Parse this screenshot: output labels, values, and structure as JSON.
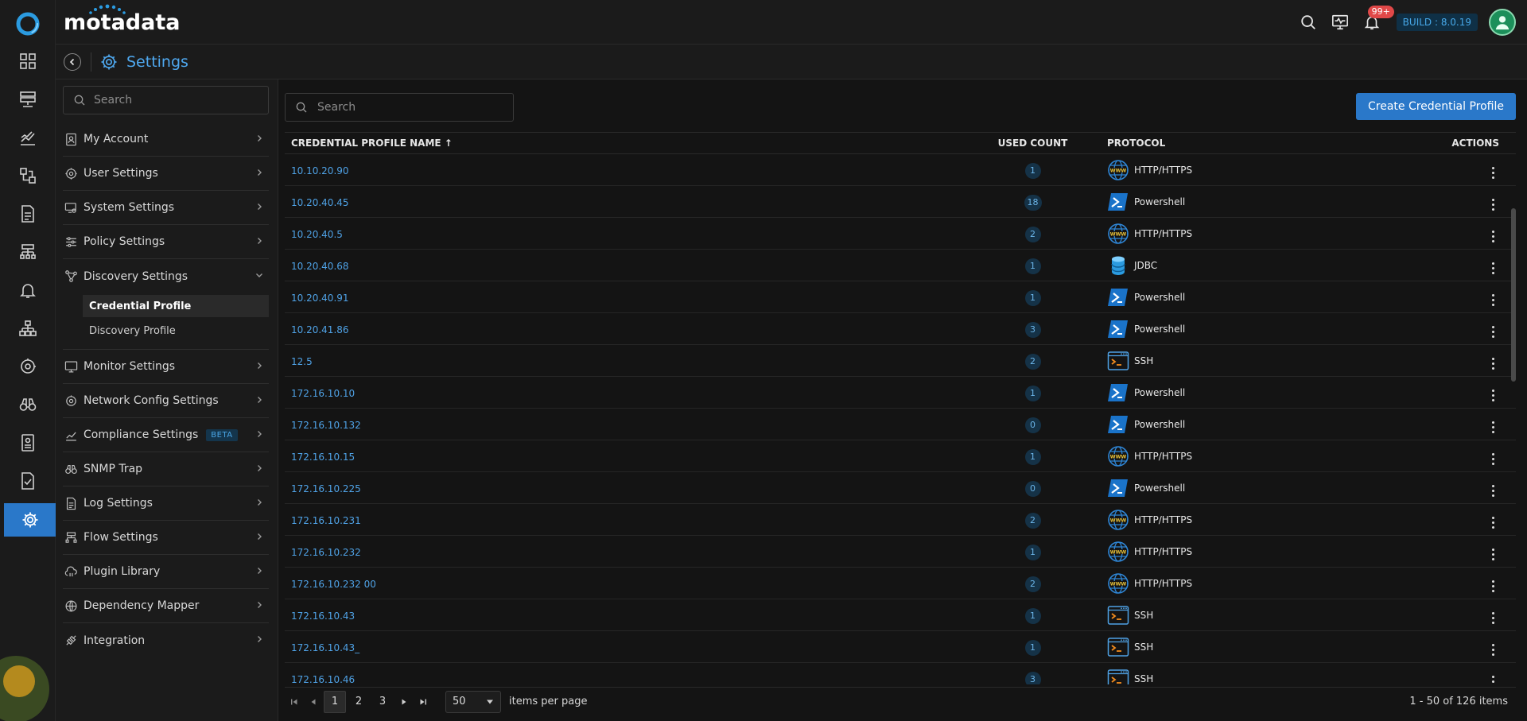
{
  "brand": {
    "name": "motadata"
  },
  "topbar": {
    "notification_count": "99+",
    "build": "BUILD : 8.0.19"
  },
  "page": {
    "title": "Settings"
  },
  "sidebar": {
    "search_placeholder": "Search",
    "items": [
      {
        "label": "My Account",
        "icon": "account-icon"
      },
      {
        "label": "User Settings",
        "icon": "user-settings-icon"
      },
      {
        "label": "System Settings",
        "icon": "system-settings-icon"
      },
      {
        "label": "Policy Settings",
        "icon": "policy-settings-icon"
      },
      {
        "label": "Discovery Settings",
        "icon": "discovery-icon",
        "expanded": true,
        "children": [
          "Credential Profile",
          "Discovery Profile"
        ],
        "active_child": "Credential Profile"
      },
      {
        "label": "Monitor Settings",
        "icon": "monitor-icon"
      },
      {
        "label": "Network Config Settings",
        "icon": "network-config-icon"
      },
      {
        "label": "Compliance Settings",
        "icon": "compliance-icon",
        "badge": "BETA"
      },
      {
        "label": "SNMP Trap",
        "icon": "binoculars-icon"
      },
      {
        "label": "Log Settings",
        "icon": "log-icon"
      },
      {
        "label": "Flow Settings",
        "icon": "flow-icon"
      },
      {
        "label": "Plugin Library",
        "icon": "plugin-icon"
      },
      {
        "label": "Dependency Mapper",
        "icon": "dependency-icon"
      },
      {
        "label": "Integration",
        "icon": "integration-icon"
      }
    ]
  },
  "main": {
    "search_placeholder": "Search",
    "create_button": "Create Credential Profile",
    "columns": {
      "name": "CREDENTIAL PROFILE NAME",
      "sort": "↑",
      "count": "USED COUNT",
      "protocol": "PROTOCOL",
      "actions": "ACTIONS"
    },
    "rows": [
      {
        "name": "10.10.20.90",
        "count": "1",
        "protocol": "HTTP/HTTPS"
      },
      {
        "name": "10.20.40.45",
        "count": "18",
        "protocol": "Powershell"
      },
      {
        "name": "10.20.40.5",
        "count": "2",
        "protocol": "HTTP/HTTPS"
      },
      {
        "name": "10.20.40.68",
        "count": "1",
        "protocol": "JDBC"
      },
      {
        "name": "10.20.40.91",
        "count": "1",
        "protocol": "Powershell"
      },
      {
        "name": "10.20.41.86",
        "count": "3",
        "protocol": "Powershell"
      },
      {
        "name": "12.5",
        "count": "2",
        "protocol": "SSH"
      },
      {
        "name": "172.16.10.10",
        "count": "1",
        "protocol": "Powershell"
      },
      {
        "name": "172.16.10.132",
        "count": "0",
        "protocol": "Powershell"
      },
      {
        "name": "172.16.10.15",
        "count": "1",
        "protocol": "HTTP/HTTPS"
      },
      {
        "name": "172.16.10.225",
        "count": "0",
        "protocol": "Powershell"
      },
      {
        "name": "172.16.10.231",
        "count": "2",
        "protocol": "HTTP/HTTPS"
      },
      {
        "name": "172.16.10.232",
        "count": "1",
        "protocol": "HTTP/HTTPS"
      },
      {
        "name": "172.16.10.232 00",
        "count": "2",
        "protocol": "HTTP/HTTPS"
      },
      {
        "name": "172.16.10.43",
        "count": "1",
        "protocol": "SSH"
      },
      {
        "name": "172.16.10.43_",
        "count": "1",
        "protocol": "SSH"
      },
      {
        "name": "172.16.10.46",
        "count": "3",
        "protocol": "SSH"
      }
    ],
    "pagination": {
      "pages": [
        "1",
        "2",
        "3"
      ],
      "current": "1",
      "page_size": "50",
      "page_size_label": "items per page",
      "info": "1 - 50 of 126 items"
    }
  },
  "colors": {
    "accent": "#2a78c9",
    "link": "#4fa2e6",
    "badge": "#e04848",
    "background": "#141414"
  }
}
